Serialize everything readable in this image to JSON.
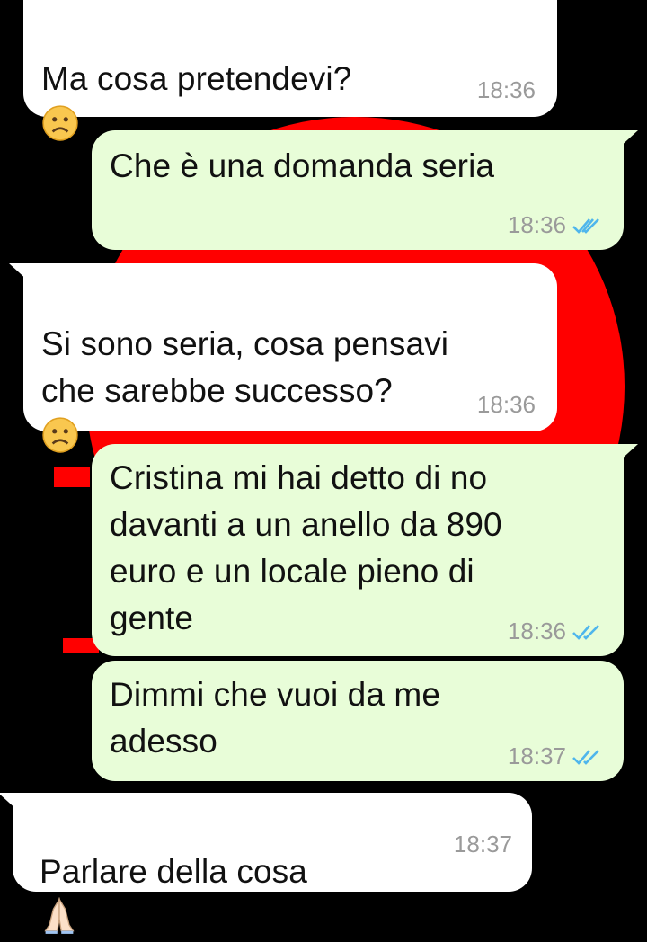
{
  "colors": {
    "incoming_bubble": "#ffffff",
    "outgoing_bubble": "#e8fdd8",
    "timestamp": "#9a9a9a",
    "read_ticks": "#4fb6ec",
    "wallpaper_bg": "#000000",
    "wallpaper_accent": "#ff0000"
  },
  "messages": [
    {
      "direction": "incoming",
      "text": "Ma cosa pretendevi?",
      "emoji": "frowning-face-icon",
      "time": "18:36"
    },
    {
      "direction": "outgoing",
      "text": "Che è una domanda seria",
      "time": "18:36",
      "status": "read"
    },
    {
      "direction": "incoming",
      "text": "Si sono seria, cosa pensavi\nche sarebbe successo?",
      "emoji": "frowning-face-icon",
      "time": "18:36"
    },
    {
      "direction": "outgoing",
      "text": "Cristina mi hai detto di no\ndavanti a un anello da 890\neuro e un locale pieno di\ngente",
      "time": "18:36",
      "status": "read"
    },
    {
      "direction": "outgoing",
      "text": "Dimmi che vuoi da me\nadesso",
      "time": "18:37",
      "status": "read"
    },
    {
      "direction": "incoming",
      "text": "Parlare della cosa",
      "emoji": "folded-hands-icon",
      "time": "18:37"
    }
  ]
}
